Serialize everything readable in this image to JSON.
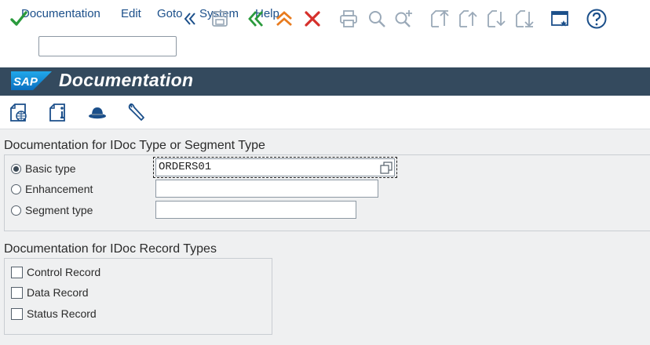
{
  "menu": [
    "Documentation",
    "Edit",
    "Goto",
    "System",
    "Help"
  ],
  "toolbar": {
    "command_value": "",
    "icons": [
      "enter-icon",
      "expand-icon",
      "save-icon",
      "back-icon",
      "exit-icon",
      "cancel-icon",
      "print-icon",
      "find-icon",
      "find-next-icon",
      "first-page-icon",
      "previous-page-icon",
      "next-page-icon",
      "last-page-icon",
      "customize-layout-icon",
      "help-icon"
    ],
    "colors": {
      "enter": "#2a9a3c",
      "back": "#2a9a3c",
      "exit": "#e87b1e",
      "cancel": "#d6302b",
      "accent": "#1b4f8a"
    }
  },
  "titlebar": {
    "logo_text": "SAP",
    "title": "Documentation",
    "bg": "#344a5e"
  },
  "app_toolbar": {
    "icons": [
      "globe-document-icon",
      "info-document-icon",
      "hat-icon",
      "wrench-icon"
    ]
  },
  "idoc_type": {
    "group_title": "Documentation for IDoc Type or Segment Type",
    "options": [
      {
        "label": "Basic type",
        "selected": true,
        "value": "ORDERS01"
      },
      {
        "label": "Enhancement",
        "selected": false,
        "value": ""
      },
      {
        "label": "Segment type",
        "selected": false,
        "value": ""
      }
    ]
  },
  "record_types": {
    "group_title": "Documentation for IDoc Record Types",
    "options": [
      {
        "label": "Control Record",
        "checked": false
      },
      {
        "label": "Data Record",
        "checked": false
      },
      {
        "label": "Status Record",
        "checked": false
      }
    ]
  }
}
